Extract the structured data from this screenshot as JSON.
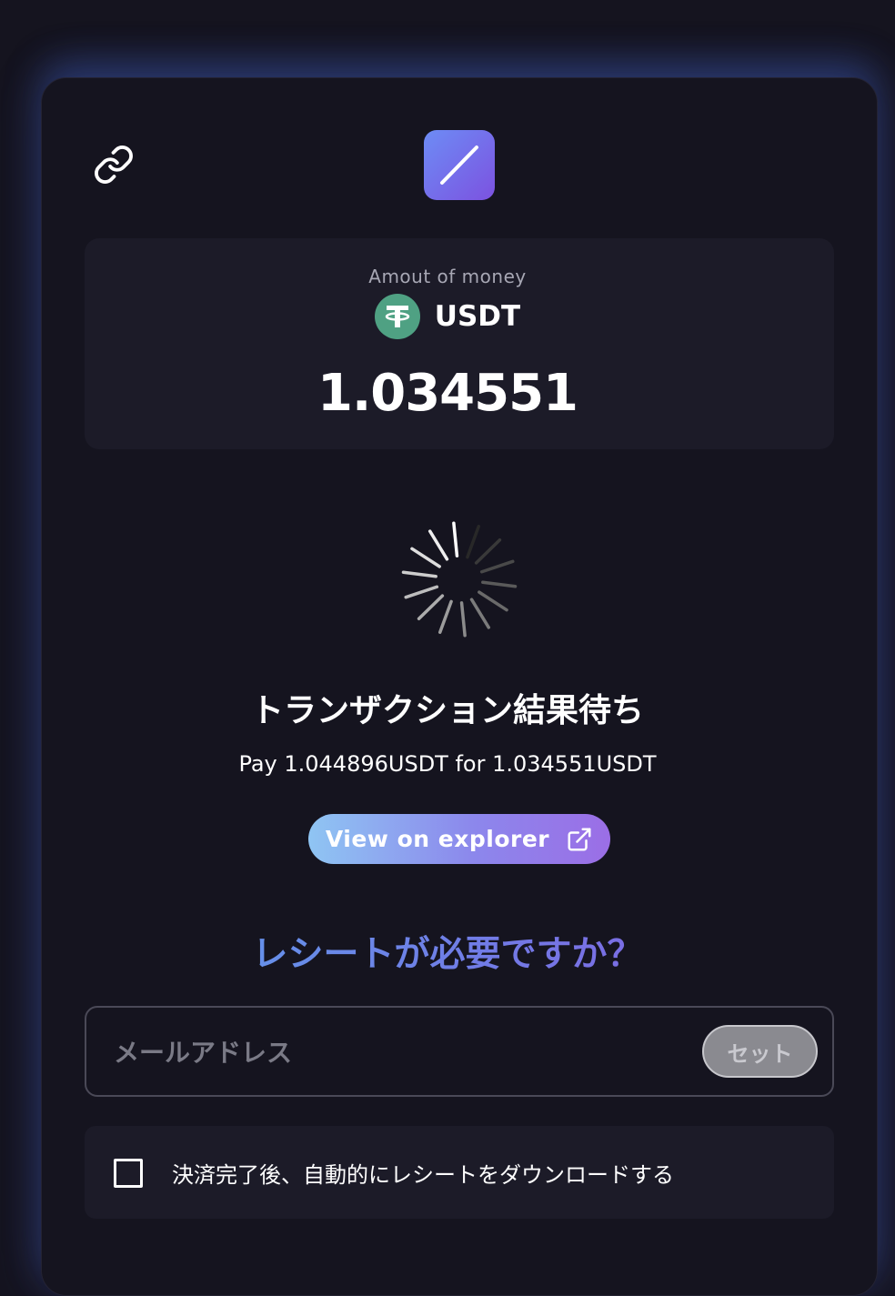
{
  "header": {
    "link_icon": "link-icon",
    "logo_icon": "app-logo"
  },
  "amount": {
    "label": "Amout of money",
    "coin_icon": "tether-icon",
    "coin": "USDT",
    "value": "1.034551"
  },
  "status": {
    "spinner_icon": "loading-spinner",
    "title": "トランザクション結果待ち",
    "pay_text": "Pay 1.044896USDT for 1.034551USDT",
    "explorer_button": "View on explorer",
    "explorer_icon": "external-link-icon"
  },
  "receipt": {
    "heading": "レシートが必要ですか？",
    "email_placeholder": "メールアドレス",
    "email_value": "",
    "set_button": "セット",
    "auto_download_label": "決済完了後、自動的にレシートをダウンロードする",
    "auto_download_checked": false
  },
  "colors": {
    "background": "#15141f",
    "panel": "#1c1b28",
    "tether_green": "#4fa183",
    "accent_gradient_start": "#8fc5f3",
    "accent_gradient_end": "#9b6ee6"
  }
}
